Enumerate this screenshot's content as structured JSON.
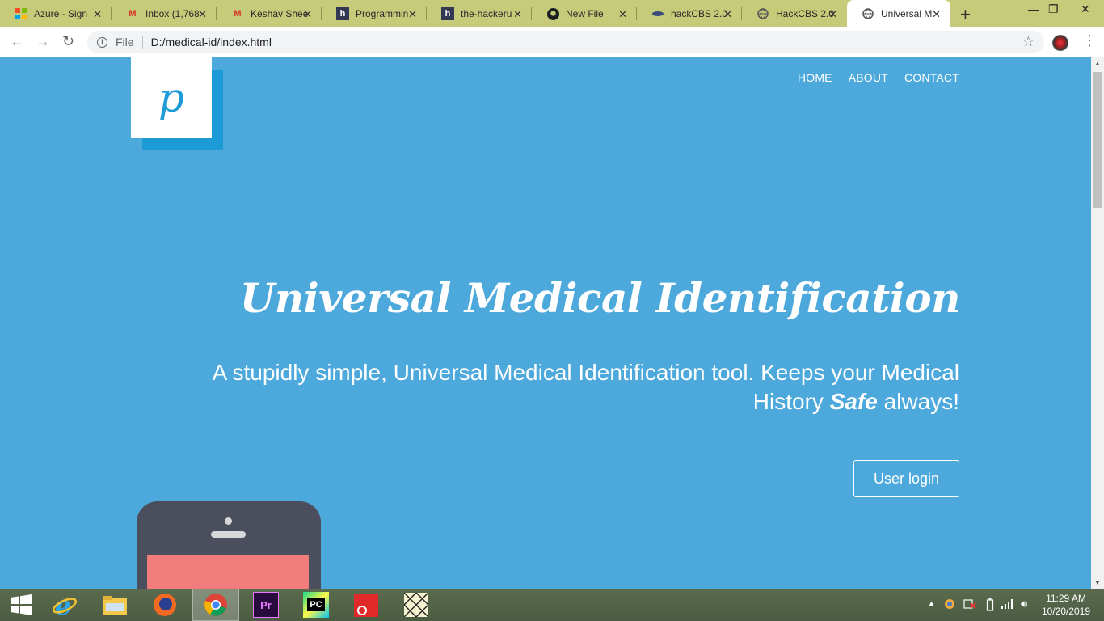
{
  "browser": {
    "tabs": [
      {
        "title": "Azure - Sign",
        "icon": "microsoft-icon"
      },
      {
        "title": "Inbox (1,768",
        "icon": "gmail-icon"
      },
      {
        "title": "Kēshāv Shēē",
        "icon": "gmail-icon"
      },
      {
        "title": "Programmin",
        "icon": "hackerearth-icon"
      },
      {
        "title": "the-hackeru",
        "icon": "hackerearth-icon"
      },
      {
        "title": "New File",
        "icon": "github-icon"
      },
      {
        "title": "hackCBS 2.0",
        "icon": "hackcbs-icon"
      },
      {
        "title": "HackCBS 2.0",
        "icon": "globe-icon"
      },
      {
        "title": "Universal M",
        "icon": "globe-icon",
        "active": true
      }
    ],
    "address": {
      "scheme_label": "File",
      "url": "D:/medical-id/index.html"
    }
  },
  "page": {
    "logo_letter": "p",
    "nav": [
      "HOME",
      "ABOUT",
      "CONTACT"
    ],
    "hero": {
      "title": "Universal Medical Identification",
      "subtitle_before": "A stupidly simple, Universal Medical Identification tool. Keeps your Medical History ",
      "subtitle_emphasis": "Safe",
      "subtitle_after": " always!",
      "button": "User login"
    },
    "colors": {
      "background": "#4da9dc",
      "logo_accent": "#1d9bd7",
      "phone_body": "#4a4e5d",
      "phone_screen": "#f27b7b"
    }
  },
  "taskbar": {
    "apps": [
      "start-icon",
      "internet-explorer-icon",
      "file-explorer-icon",
      "firefox-icon",
      "chrome-icon",
      "premiere-pro-icon",
      "pycharm-icon",
      "camera-app-icon",
      "pattern-app-icon"
    ],
    "clock": {
      "time": "11:29 AM",
      "date": "10/20/2019"
    }
  }
}
